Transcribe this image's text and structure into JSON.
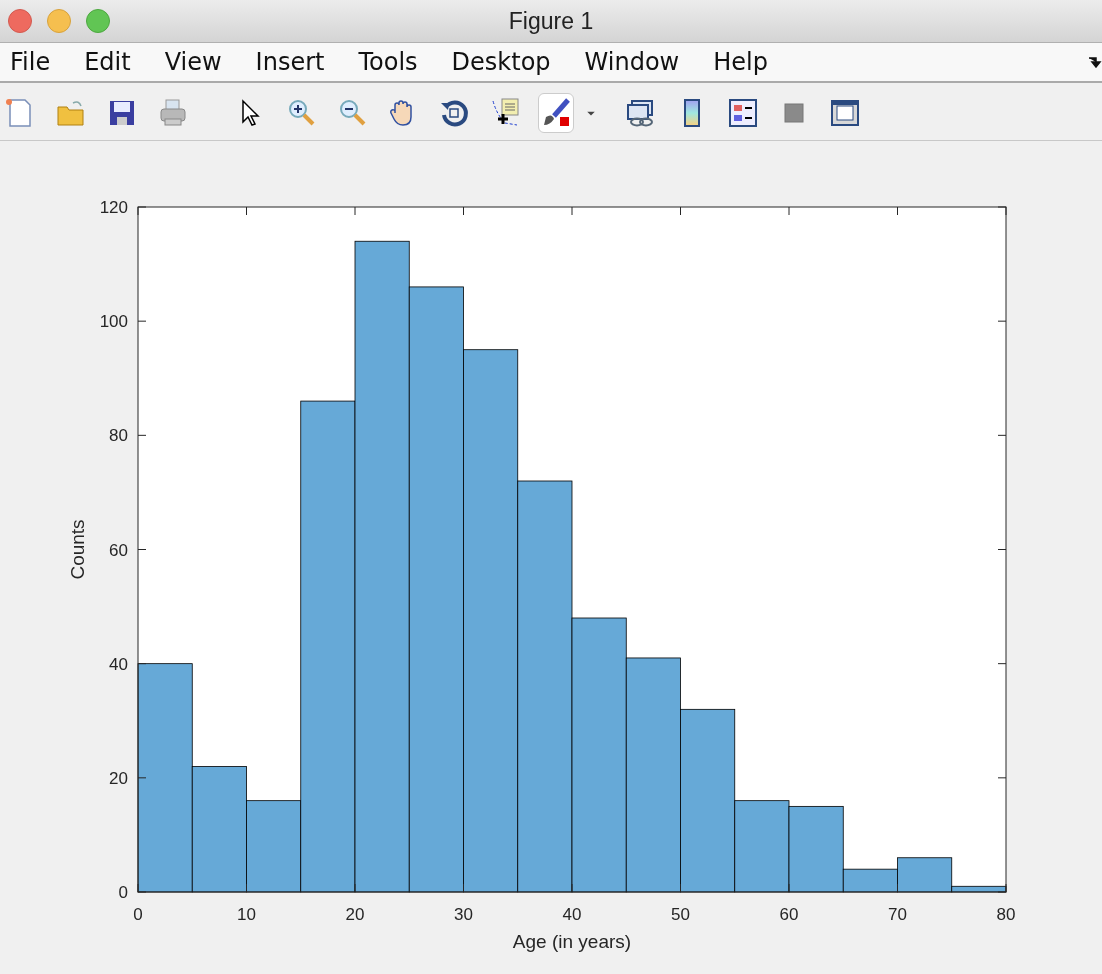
{
  "window": {
    "title": "Figure 1"
  },
  "menu": [
    "File",
    "Edit",
    "View",
    "Insert",
    "Tools",
    "Desktop",
    "Window",
    "Help"
  ],
  "toolbar": [
    {
      "kind": "new",
      "pressed": false
    },
    {
      "kind": "open",
      "pressed": false
    },
    {
      "kind": "save",
      "pressed": false
    },
    {
      "kind": "print",
      "pressed": false
    },
    {
      "kind": "gap"
    },
    {
      "kind": "pointer",
      "pressed": false
    },
    {
      "kind": "zoomin",
      "pressed": false
    },
    {
      "kind": "zoomout",
      "pressed": false
    },
    {
      "kind": "pan",
      "pressed": false
    },
    {
      "kind": "rotate",
      "pressed": false
    },
    {
      "kind": "datatip",
      "pressed": false
    },
    {
      "kind": "brush",
      "pressed": true
    },
    {
      "kind": "caret"
    },
    {
      "kind": "link",
      "pressed": false
    },
    {
      "kind": "colorbar",
      "pressed": false
    },
    {
      "kind": "legend",
      "pressed": false
    },
    {
      "kind": "hide",
      "pressed": false
    },
    {
      "kind": "plottools",
      "pressed": false
    }
  ],
  "figure": {
    "chart_data": {
      "type": "bar",
      "xlabel": "Age (in years)",
      "ylabel": "Counts",
      "x": [
        2.5,
        7.5,
        12.5,
        17.5,
        22.5,
        27.5,
        32.5,
        37.5,
        42.5,
        47.5,
        52.5,
        57.5,
        62.5,
        67.5,
        72.5,
        77.5
      ],
      "values": [
        40,
        22,
        16,
        86,
        114,
        106,
        95,
        72,
        48,
        41,
        32,
        16,
        15,
        4,
        6,
        1
      ],
      "xlim": [
        0,
        80
      ],
      "ylim": [
        0,
        120
      ],
      "xticks": [
        0,
        10,
        20,
        30,
        40,
        50,
        60,
        70,
        80
      ],
      "yticks": [
        0,
        20,
        40,
        60,
        80,
        100,
        120
      ]
    }
  }
}
